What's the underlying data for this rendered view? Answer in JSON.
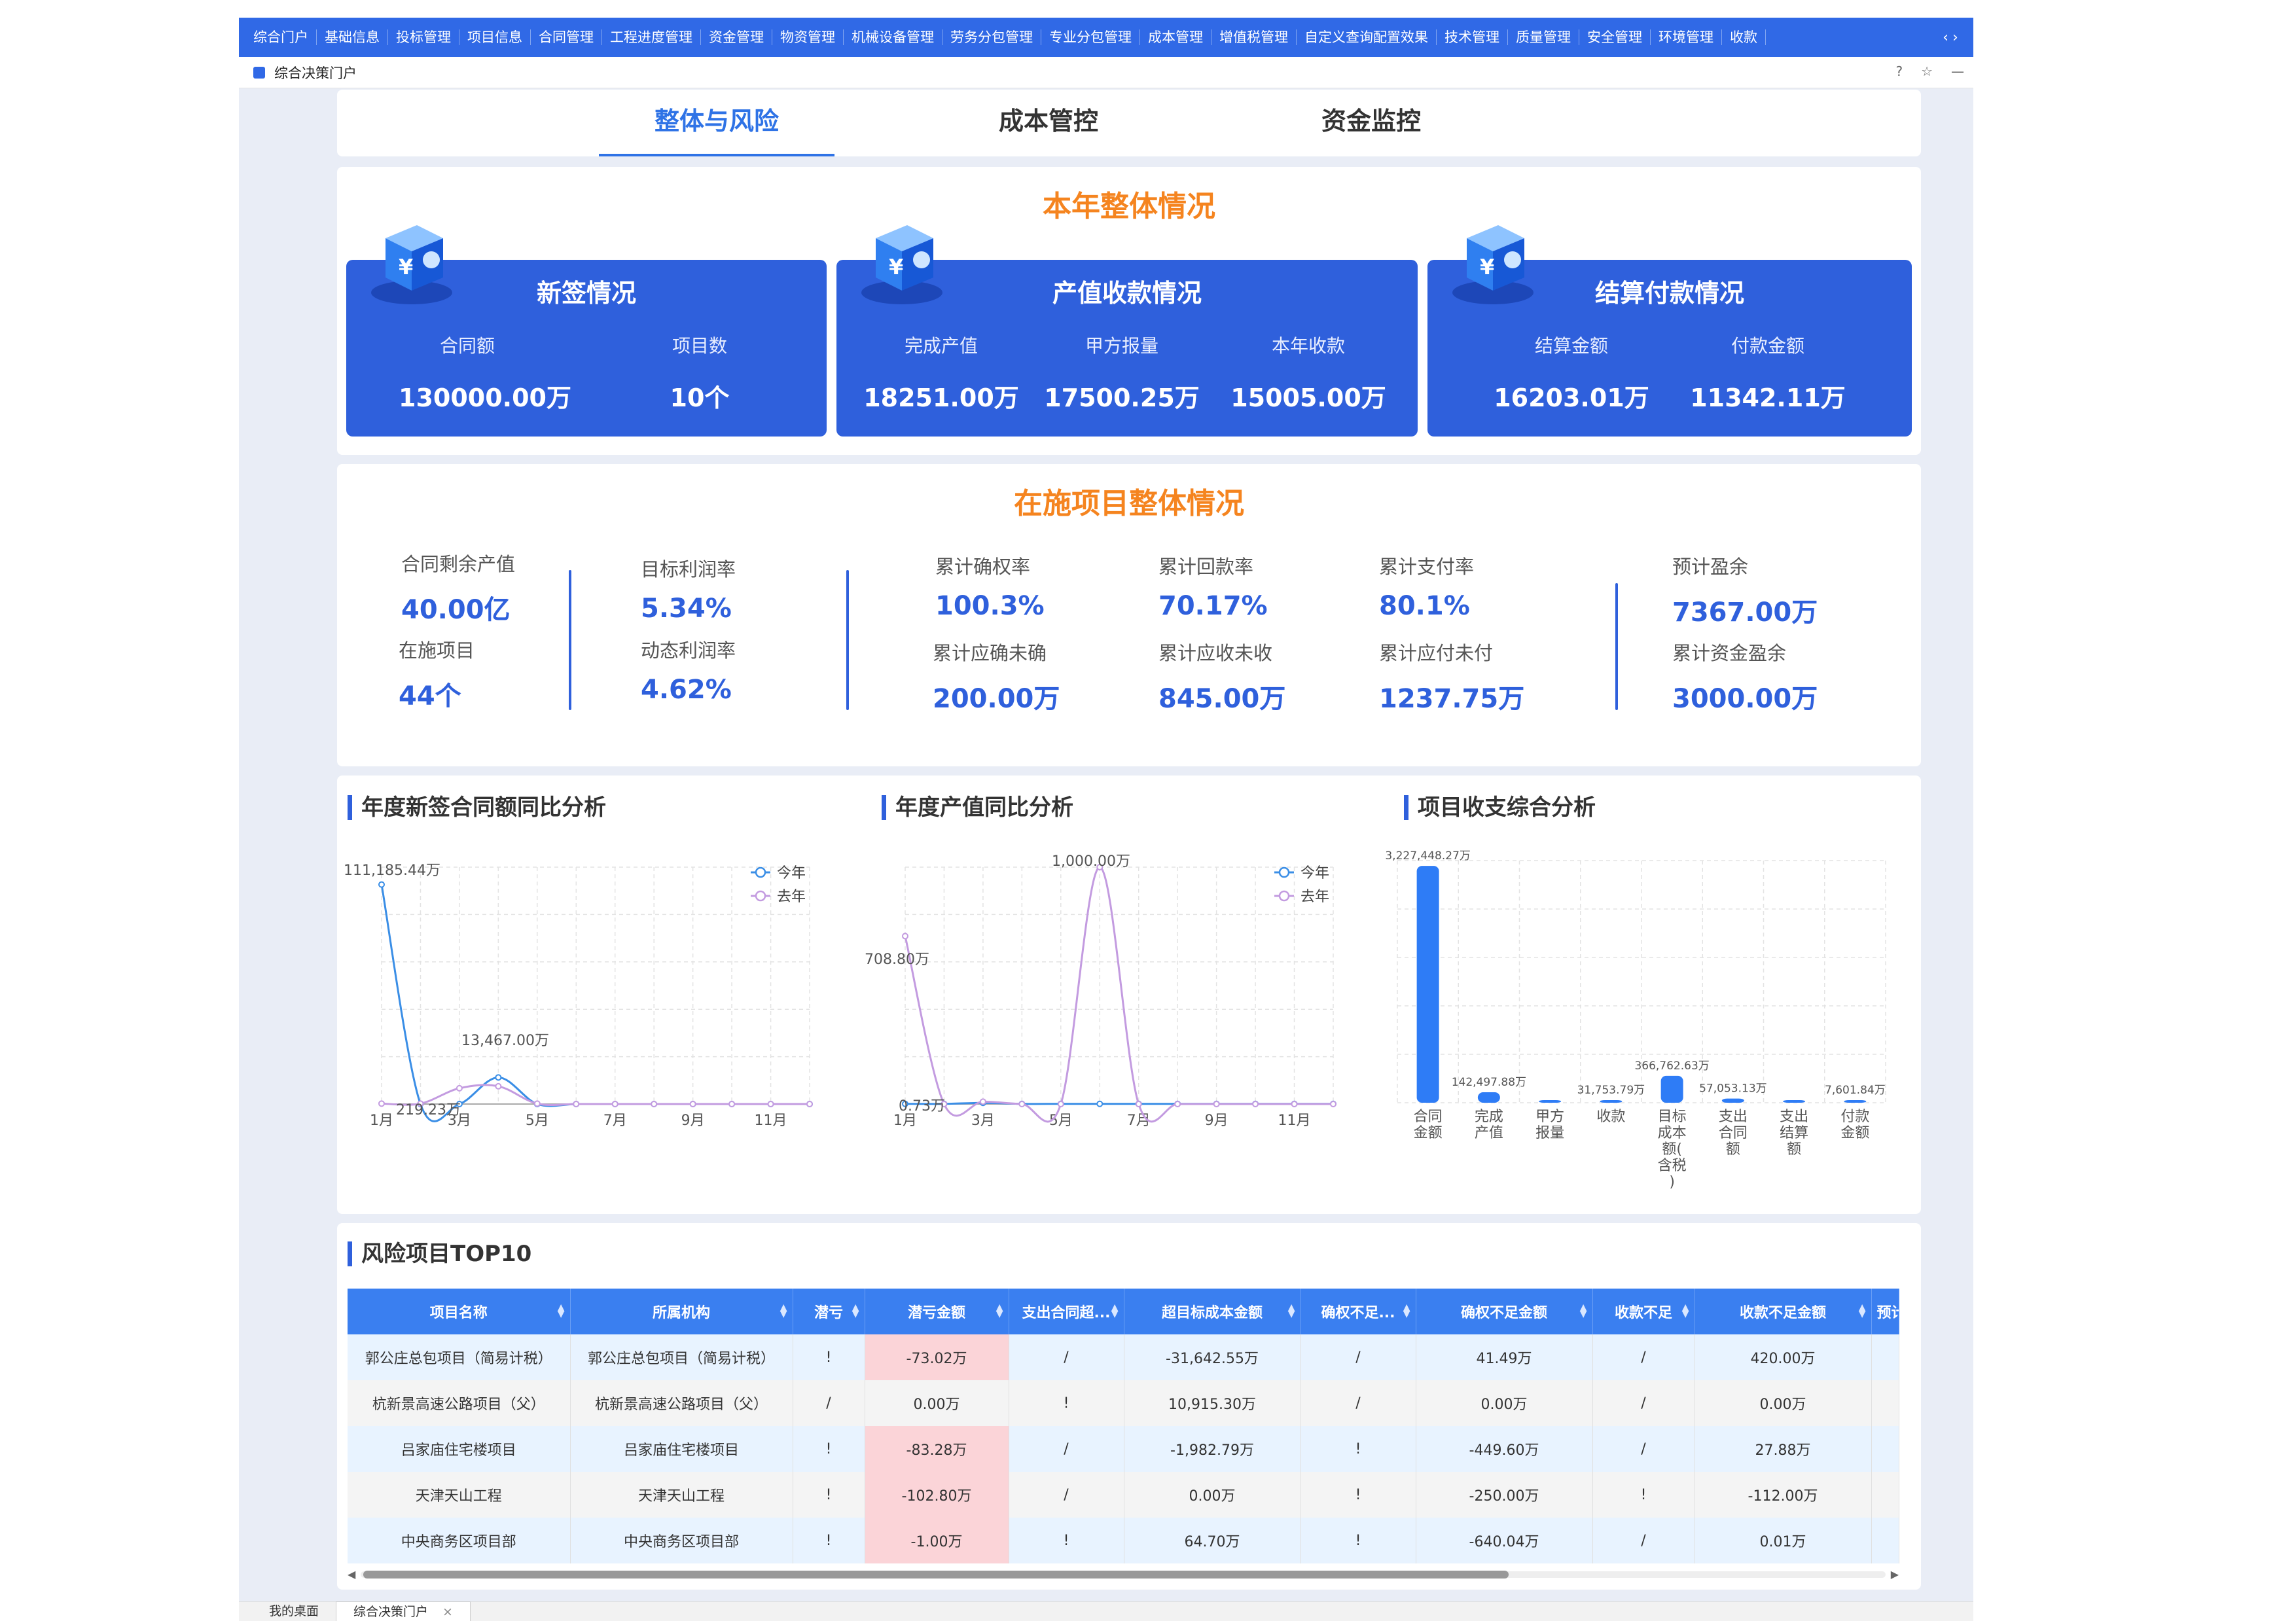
{
  "nav": {
    "items": [
      "综合门户",
      "基础信息",
      "投标管理",
      "项目信息",
      "合同管理",
      "工程进度管理",
      "资金管理",
      "物资管理",
      "机械设备管理",
      "劳务分包管理",
      "专业分包管理",
      "成本管理",
      "增值税管理",
      "自定义查询配置效果",
      "技术管理",
      "质量管理",
      "安全管理",
      "环境管理",
      "收款"
    ]
  },
  "page": {
    "title": "综合决策门户"
  },
  "tabs": [
    "整体与风险",
    "成本管控",
    "资金监控"
  ],
  "year": {
    "title": "本年整体情况",
    "cards": [
      {
        "title": "新签情况",
        "metrics": [
          {
            "label": "合同额",
            "value": "130000.00万"
          },
          {
            "label": "项目数",
            "value": "10个"
          }
        ]
      },
      {
        "title": "产值收款情况",
        "metrics": [
          {
            "label": "完成产值",
            "value": "18251.00万"
          },
          {
            "label": "甲方报量",
            "value": "17500.25万"
          },
          {
            "label": "本年收款",
            "value": "15005.00万"
          }
        ]
      },
      {
        "title": "结算付款情况",
        "metrics": [
          {
            "label": "结算金额",
            "value": "16203.01万"
          },
          {
            "label": "付款金额",
            "value": "11342.11万"
          }
        ]
      }
    ]
  },
  "ongoing": {
    "title": "在施项目整体情况",
    "metrics": [
      {
        "label": "合同剩余产值",
        "value": "40.00亿"
      },
      {
        "label": "在施项目",
        "value": "44个"
      },
      {
        "label": "目标利润率",
        "value": "5.34%"
      },
      {
        "label": "动态利润率",
        "value": "4.62%"
      },
      {
        "label": "累计确权率",
        "value": "100.3%"
      },
      {
        "label": "累计应确未确",
        "value": "200.00万"
      },
      {
        "label": "累计回款率",
        "value": "70.17%"
      },
      {
        "label": "累计应收未收",
        "value": "845.00万"
      },
      {
        "label": "累计支付率",
        "value": "80.1%"
      },
      {
        "label": "累计应付未付",
        "value": "1237.75万"
      },
      {
        "label": "预计盈余",
        "value": "7367.00万"
      },
      {
        "label": "累计资金盈余",
        "value": "3000.00万"
      }
    ]
  },
  "chart_data": [
    {
      "type": "line",
      "title": "年度新签合同额同比分析",
      "x": [
        "1月",
        "2月",
        "3月",
        "4月",
        "5月",
        "6月",
        "7月",
        "8月",
        "9月",
        "10月",
        "11月",
        "12月"
      ],
      "xtick_labels": [
        "1月",
        "3月",
        "5月",
        "7月",
        "9月",
        "11月"
      ],
      "series": [
        {
          "name": "今年",
          "values": [
            111185.44,
            0,
            0,
            13467,
            0,
            0,
            0,
            0,
            0,
            0,
            0,
            0
          ],
          "color": "#3a8ee6"
        },
        {
          "name": "去年",
          "values": [
            219.23,
            219.23,
            8000,
            9000,
            200,
            0,
            0,
            0,
            0,
            0,
            0,
            0
          ],
          "color": "#c39be0"
        }
      ],
      "data_labels": [
        "111,185.44万",
        "13,467.00万",
        "219.23万"
      ],
      "ylim": [
        0,
        120000
      ],
      "legend": "top-right",
      "grid": true
    },
    {
      "type": "line",
      "title": "年度产值同比分析",
      "x": [
        "1月",
        "2月",
        "3月",
        "4月",
        "5月",
        "6月",
        "7月",
        "8月",
        "9月",
        "10月",
        "11月",
        "12月"
      ],
      "xtick_labels": [
        "1月",
        "3月",
        "5月",
        "7月",
        "9月",
        "11月"
      ],
      "series": [
        {
          "name": "今年",
          "values": [
            0.73,
            0.73,
            5,
            0.73,
            0.73,
            0.73,
            0.73,
            0.73,
            0.73,
            0.73,
            0.73,
            0.73
          ],
          "color": "#3a8ee6"
        },
        {
          "name": "去年",
          "values": [
            708.8,
            0,
            10,
            0,
            0,
            1000,
            0,
            0,
            0,
            0,
            0,
            0
          ],
          "color": "#c39be0"
        }
      ],
      "data_labels": [
        "1,000.00万",
        "708.80万",
        "0.73万"
      ],
      "ylim": [
        0,
        1000
      ],
      "legend": "top-right",
      "grid": true
    },
    {
      "type": "bar",
      "title": "项目收支综合分析",
      "categories": [
        "合同金额",
        "完成产值",
        "甲方报量",
        "收款",
        "目标成本额(含税)",
        "支出合同额",
        "支出结算额",
        "付款金额"
      ],
      "values": [
        3227448.27,
        142497.88,
        0,
        31753.79,
        366762.63,
        57053.13,
        0,
        7601.84
      ],
      "data_labels": [
        "3,227,448.27万",
        "142,497.88万",
        "",
        "31,753.79万",
        "366,762.63万",
        "57,053.13万",
        "",
        "7,601.84万"
      ],
      "ylim": [
        0,
        3300000
      ],
      "grid": true
    }
  ],
  "risk": {
    "title": "风险项目TOP10",
    "columns": [
      "项目名称",
      "所属机构",
      "潜亏",
      "潜亏金额",
      "支出合同超...",
      "超目标成本金额",
      "确权不足...",
      "确权不足金额",
      "收款不足",
      "收款不足金额",
      "预计"
    ],
    "rows": [
      [
        "郭公庄总包项目（简易计税）",
        "郭公庄总包项目（简易计税）",
        "!",
        "-73.02万",
        "/",
        "-31,642.55万",
        "/",
        "41.49万",
        "/",
        "420.00万",
        ""
      ],
      [
        "杭新景高速公路项目（父）",
        "杭新景高速公路项目（父）",
        "/",
        "0.00万",
        "!",
        "10,915.30万",
        "/",
        "0.00万",
        "/",
        "0.00万",
        ""
      ],
      [
        "吕家庙住宅楼项目",
        "吕家庙住宅楼项目",
        "!",
        "-83.28万",
        "/",
        "-1,982.79万",
        "!",
        "-449.60万",
        "/",
        "27.88万",
        ""
      ],
      [
        "天津天山工程",
        "天津天山工程",
        "!",
        "-102.80万",
        "/",
        "0.00万",
        "!",
        "-250.00万",
        "!",
        "-112.00万",
        ""
      ],
      [
        "中央商务区项目部",
        "中央商务区项目部",
        "!",
        "-1.00万",
        "!",
        "64.70万",
        "!",
        "-640.04万",
        "/",
        "0.01万",
        ""
      ]
    ]
  },
  "bottom_tabs": [
    "我的桌面",
    "综合决策门户"
  ],
  "colors": {
    "accent": "#2f60dc",
    "title_orange": "#f5841f",
    "header_blue": "#3069e6",
    "risk_highlight": "#fbd4d8"
  }
}
